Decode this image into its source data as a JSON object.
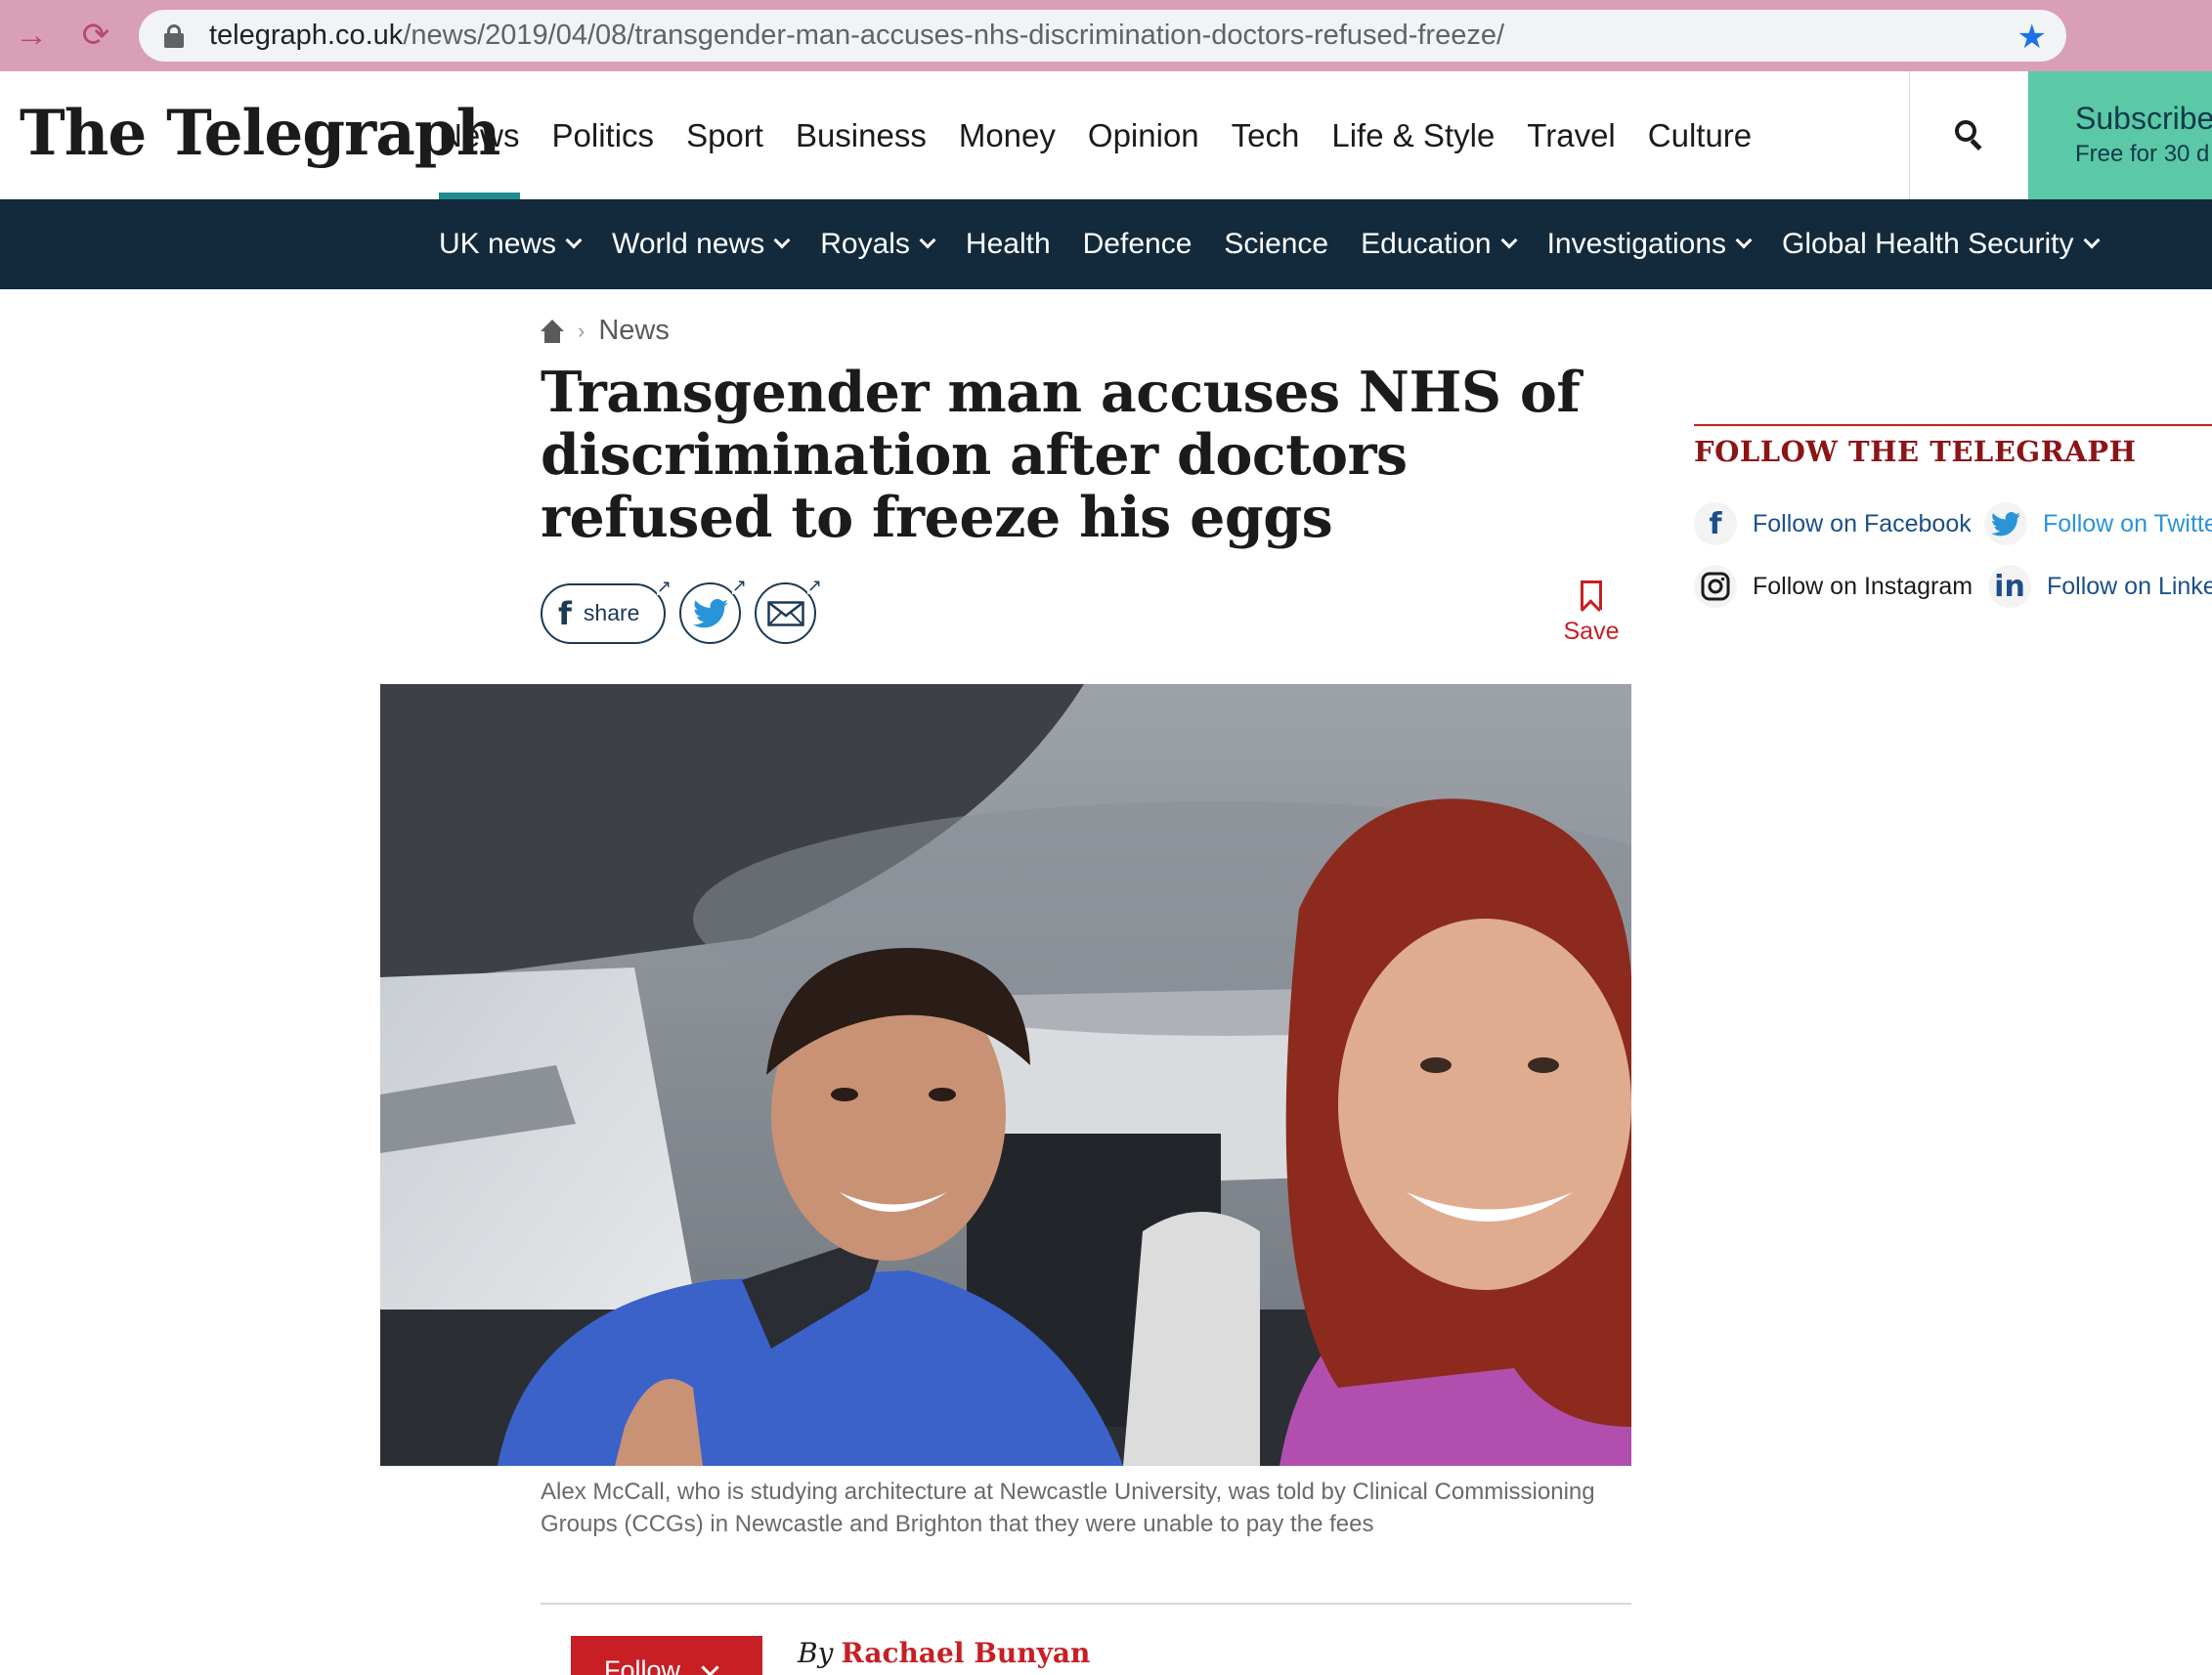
{
  "browser": {
    "url_domain": "telegraph.co.uk",
    "url_path": "/news/2019/04/08/transgender-man-accuses-nhs-discrimination-doctors-refused-freeze/"
  },
  "header": {
    "logo": "The Telegraph",
    "nav": [
      "News",
      "Politics",
      "Sport",
      "Business",
      "Money",
      "Opinion",
      "Tech",
      "Life & Style",
      "Travel",
      "Culture"
    ],
    "active_nav": "News",
    "subscribe_title": "Subscribe",
    "subscribe_sub": "Free for 30 d"
  },
  "subnav": {
    "items": [
      {
        "label": "UK news",
        "dropdown": true
      },
      {
        "label": "World news",
        "dropdown": true
      },
      {
        "label": "Royals",
        "dropdown": true
      },
      {
        "label": "Health",
        "dropdown": false
      },
      {
        "label": "Defence",
        "dropdown": false
      },
      {
        "label": "Science",
        "dropdown": false
      },
      {
        "label": "Education",
        "dropdown": true
      },
      {
        "label": "Investigations",
        "dropdown": true
      },
      {
        "label": "Global Health Security",
        "dropdown": true
      }
    ]
  },
  "article": {
    "breadcrumb": "News",
    "headline": "Transgender man accuses NHS of discrimination after doctors refused to freeze his eggs",
    "share_label": "share",
    "save_label": "Save",
    "caption": "Alex McCall, who is studying architecture at Newcastle University, was told by Clinical Commissioning Groups (CCGs) in Newcastle and Brighton that they were unable to pay the fees",
    "follow_label": "Follow",
    "byline_prefix": "By",
    "author": "Rachael Bunyan"
  },
  "sidebar": {
    "title": "FOLLOW THE TELEGRAPH",
    "facebook": "Follow on Facebook",
    "twitter": "Follow on Twitte",
    "instagram": "Follow on Instagram",
    "linkedin": "Follow on Linke"
  },
  "colors": {
    "accent_red": "#c71f24",
    "nav_dark": "#122a3b",
    "active_underline": "#1f8a8f",
    "subscribe_bg": "#5bc8a6",
    "browser_bar": "#d99fb6"
  }
}
